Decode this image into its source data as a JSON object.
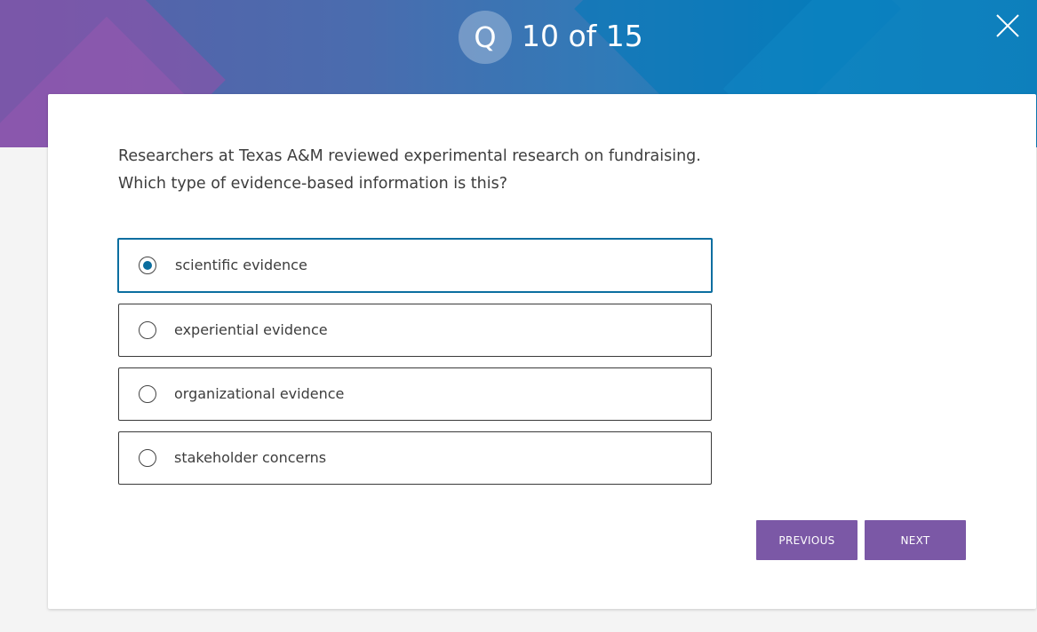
{
  "header": {
    "badge_letter": "Q",
    "progress_text": "10 of 15",
    "close_icon": "close-icon"
  },
  "question": {
    "line1": "Researchers at Texas A&M reviewed experimental research on fundraising.",
    "line2": "Which type of evidence-based information is this?"
  },
  "options": [
    {
      "label": "scientific evidence",
      "selected": true
    },
    {
      "label": "experiential evidence",
      "selected": false
    },
    {
      "label": "organizational evidence",
      "selected": false
    },
    {
      "label": "stakeholder concerns",
      "selected": false
    }
  ],
  "navigation": {
    "previous_label": "PREVIOUS",
    "next_label": "NEXT"
  },
  "colors": {
    "accent_purple": "#7b58a6",
    "selected_border": "#0b6ea0",
    "radio_fill": "#0a6d9e"
  }
}
